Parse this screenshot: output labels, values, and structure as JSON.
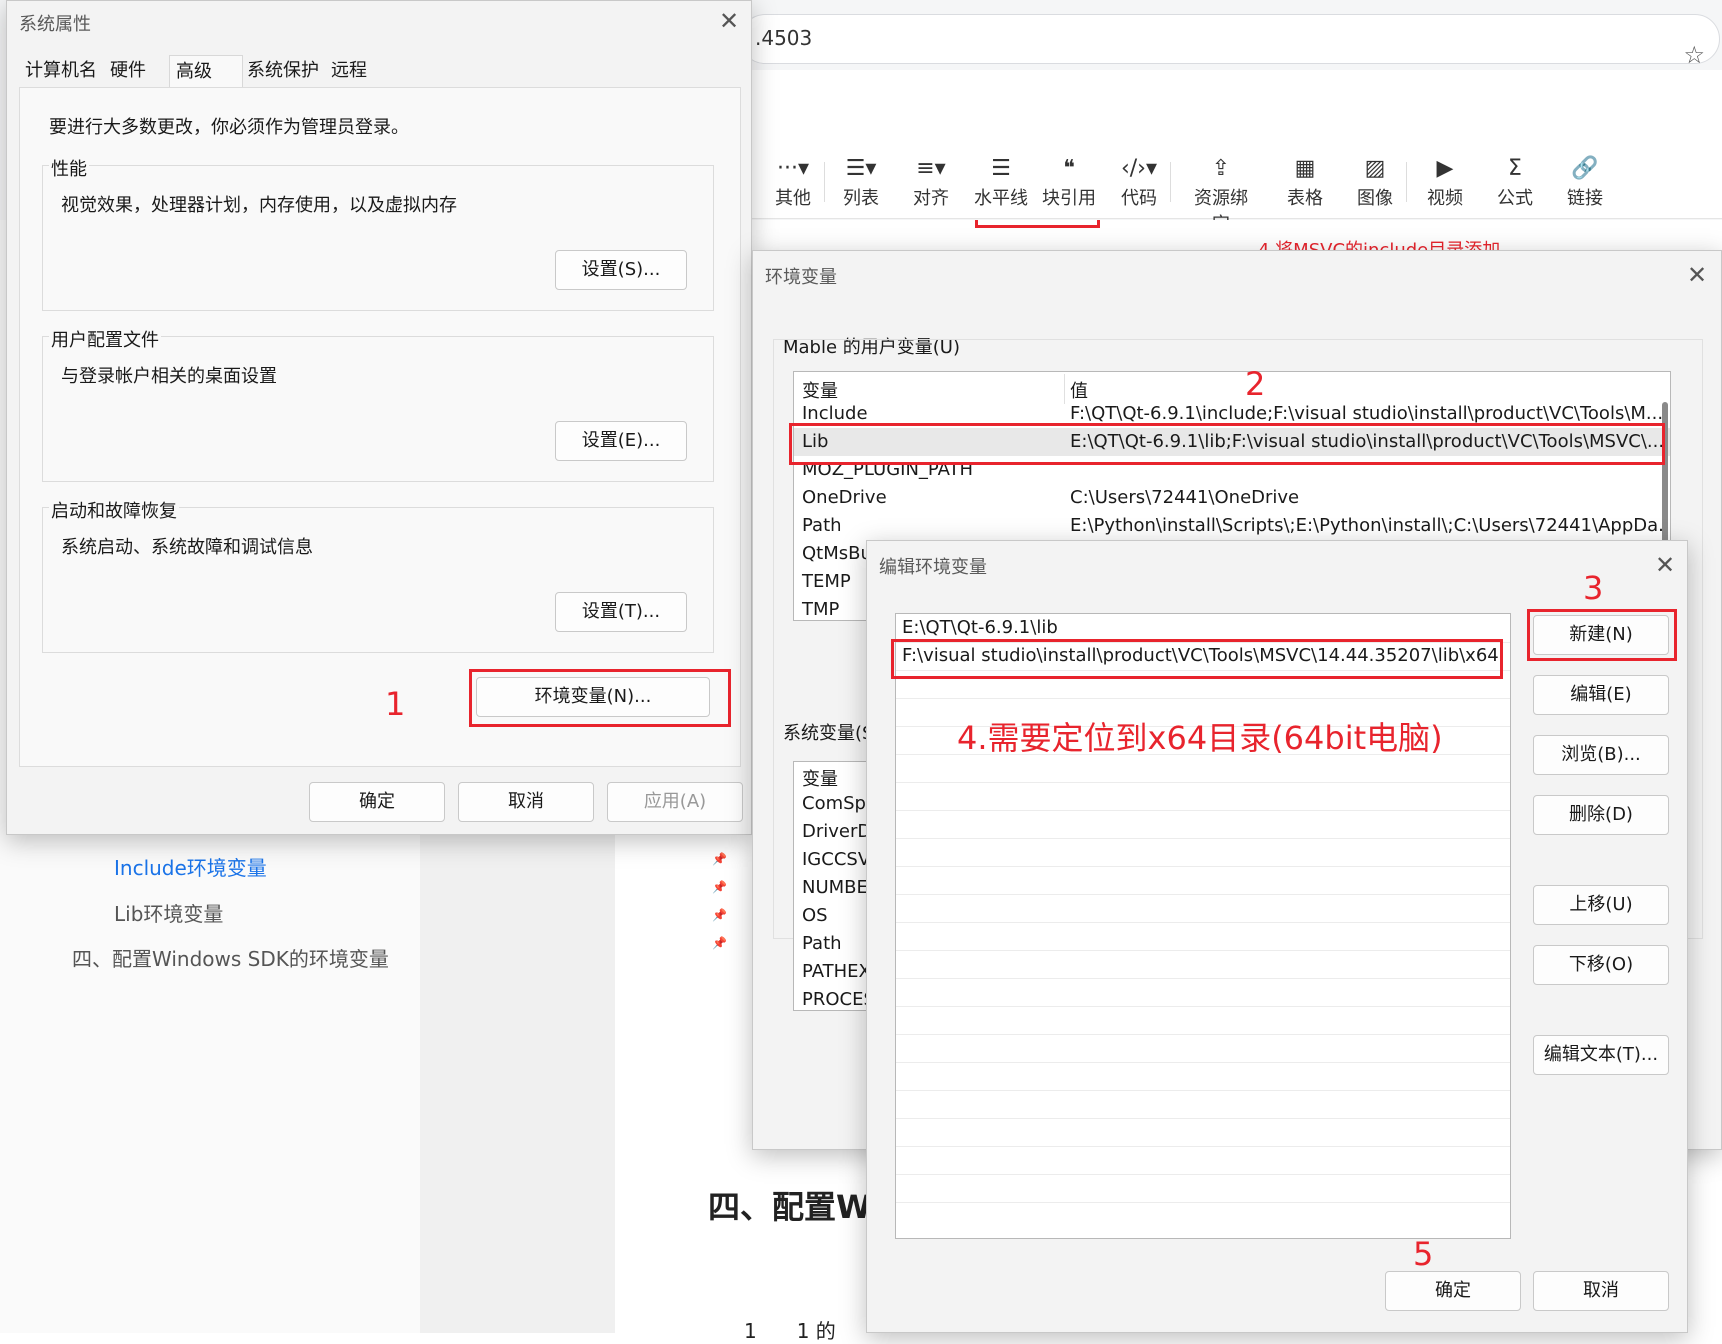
{
  "browser": {
    "url_fragment": ".4503",
    "star_icon": "star-icon"
  },
  "editor_toolbar": [
    {
      "label": "其他",
      "icon": "···▾"
    },
    {
      "label": "列表",
      "icon": "☰▾"
    },
    {
      "label": "对齐",
      "icon": "≡▾"
    },
    {
      "label": "水平线",
      "icon": "☰"
    },
    {
      "label": "块引用",
      "icon": "❝"
    },
    {
      "label": "代码",
      "icon": "‹/›▾"
    },
    {
      "label": "资源绑定",
      "icon": "⇪"
    },
    {
      "label": "表格",
      "icon": "▦"
    },
    {
      "label": "图像",
      "icon": "▨"
    },
    {
      "label": "视频",
      "icon": "▶"
    },
    {
      "label": "公式",
      "icon": "Σ"
    },
    {
      "label": "链接",
      "icon": "🔗"
    }
  ],
  "doc": {
    "toc_include": "Include环境变量",
    "toc_lib": "Lib环境变量",
    "toc_section4": "四、配置Windows SDK的环境变量",
    "heading_partial": "四、配置W",
    "bottom_partial": "1　　1 的",
    "snippet_red": "4.将MSVC的include目录添加"
  },
  "sys_props": {
    "title": "系统属性",
    "tabs": [
      "计算机名",
      "硬件",
      "高级",
      "系统保护",
      "远程"
    ],
    "admin_note": "要进行大多数更改，你必须作为管理员登录。",
    "perf_label": "性能",
    "perf_desc": "视觉效果，处理器计划，内存使用，以及虚拟内存",
    "perf_btn": "设置(S)...",
    "profile_label": "用户配置文件",
    "profile_desc": "与登录帐户相关的桌面设置",
    "profile_btn": "设置(E)...",
    "startup_label": "启动和故障恢复",
    "startup_desc": "系统启动、系统故障和调试信息",
    "startup_btn": "设置(T)...",
    "env_btn": "环境变量(N)...",
    "ok": "确定",
    "cancel": "取消",
    "apply": "应用(A)"
  },
  "env_vars": {
    "title": "环境变量",
    "user_group": "Mable 的用户变量(U)",
    "col_var": "变量",
    "col_val": "值",
    "user_rows": [
      {
        "name": "Include",
        "value": "F:\\QT\\Qt-6.9.1\\include;F:\\visual studio\\install\\product\\VC\\Tools\\M..."
      },
      {
        "name": "Lib",
        "value": "E:\\QT\\Qt-6.9.1\\lib;F:\\visual studio\\install\\product\\VC\\Tools\\MSVC\\..."
      },
      {
        "name": "MOZ_PLUGIN_PATH",
        "value": ""
      },
      {
        "name": "OneDrive",
        "value": "C:\\Users\\72441\\OneDrive"
      },
      {
        "name": "Path",
        "value": "E:\\Python\\install\\Scripts\\;E:\\Python\\install\\;C:\\Users\\72441\\AppDa..."
      },
      {
        "name": "QtMsBu",
        "value": ""
      },
      {
        "name": "TEMP",
        "value": ""
      },
      {
        "name": "TMP",
        "value": ""
      }
    ],
    "sys_group": "系统变量(S",
    "sys_rows": [
      "ComSp",
      "DriverD",
      "IGCCSV",
      "NUMBE",
      "OS",
      "Path",
      "PATHEX",
      "PROCES"
    ]
  },
  "edit_env": {
    "title": "编辑环境变量",
    "items": [
      "E:\\QT\\Qt-6.9.1\\lib",
      "F:\\visual studio\\install\\product\\VC\\Tools\\MSVC\\14.44.35207\\lib\\x64"
    ],
    "btn_new": "新建(N)",
    "btn_edit": "编辑(E)",
    "btn_browse": "浏览(B)...",
    "btn_delete": "删除(D)",
    "btn_up": "上移(U)",
    "btn_down": "下移(O)",
    "btn_edit_text": "编辑文本(T)...",
    "ok": "确定",
    "cancel": "取消"
  },
  "annotations": {
    "n1": "1",
    "n2": "2",
    "n3": "3",
    "n5": "5",
    "note4": "4.需要定位到x64目录(64bit电脑)",
    "color": "#e8242d"
  }
}
